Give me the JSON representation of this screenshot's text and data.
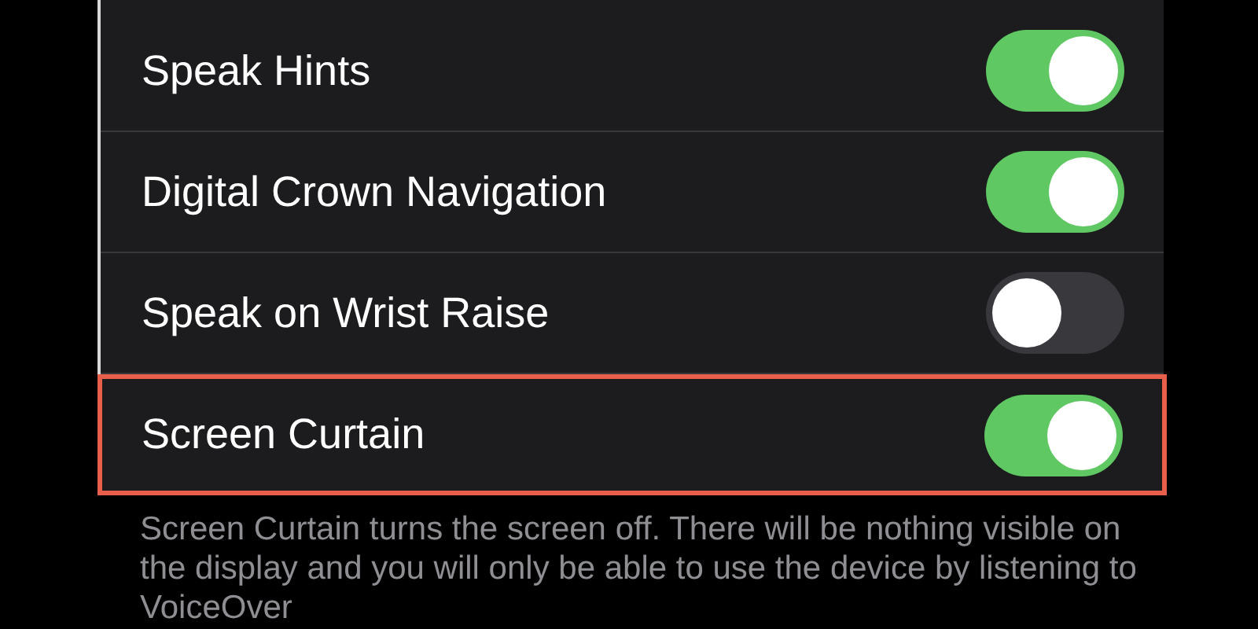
{
  "settings": [
    {
      "label": "Speak Hints",
      "on": true,
      "highlighted": false
    },
    {
      "label": "Digital Crown Navigation",
      "on": true,
      "highlighted": false
    },
    {
      "label": "Speak on Wrist Raise",
      "on": false,
      "highlighted": false
    },
    {
      "label": "Screen Curtain",
      "on": true,
      "highlighted": true
    }
  ],
  "footer": "Screen Curtain turns the screen off. There will be nothing visible on the display and you will only be able to use the device by listening to VoiceOver"
}
